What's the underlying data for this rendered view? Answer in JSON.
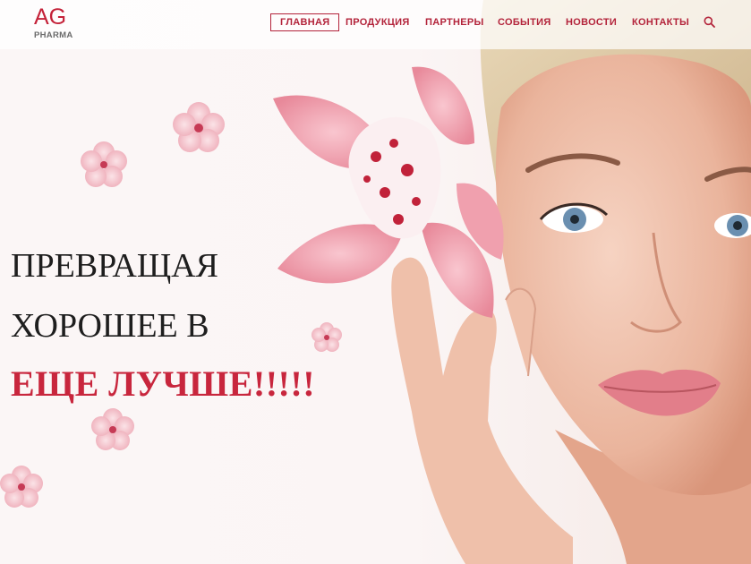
{
  "brand": {
    "logo_main": "AG",
    "logo_sub": "PHARMA",
    "accent_color": "#c42138"
  },
  "nav": {
    "items": [
      {
        "label": "ГЛАВНАЯ",
        "active": true
      },
      {
        "label": "ПРОДУКЦИЯ",
        "active": false
      },
      {
        "label": "ПАРТНЕРЫ",
        "active": false
      },
      {
        "label": "СОБЫТИЯ",
        "active": false
      },
      {
        "label": "НОВОСТИ",
        "active": false
      },
      {
        "label": "КОНТАКТЫ",
        "active": false
      }
    ],
    "search_icon": "search-icon"
  },
  "hero": {
    "line1": "ПРЕВРАЩАЯ",
    "line2": "ХОРОШЕЕ В",
    "line3": "ЕЩЕ ЛУЧШЕ!!!!!"
  }
}
